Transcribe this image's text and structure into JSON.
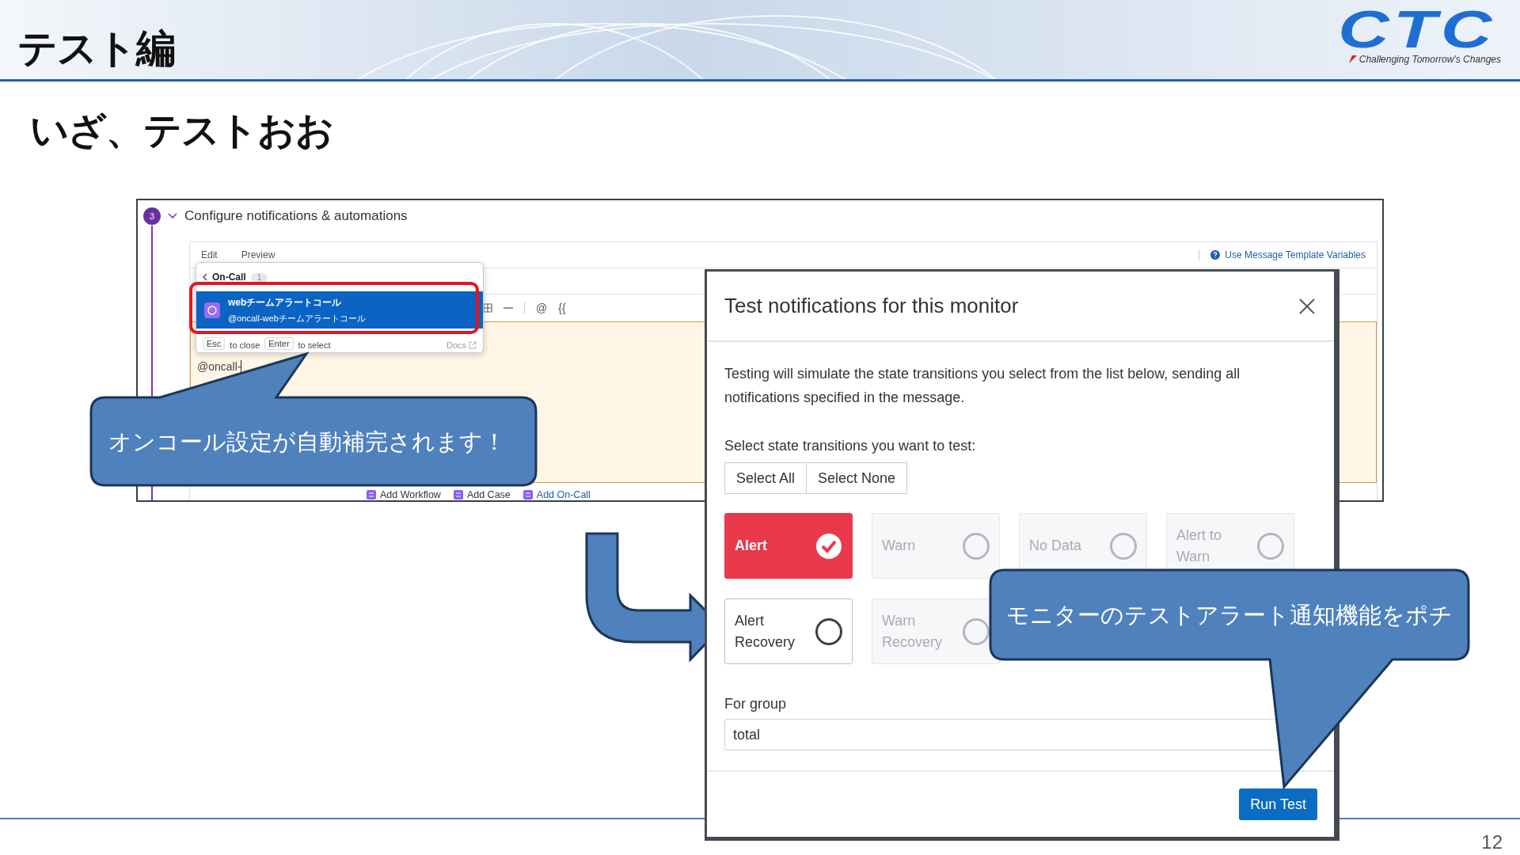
{
  "slide": {
    "title": "テスト編",
    "subtitle": "いざ、テストおお",
    "page_number": "12",
    "logo": {
      "text": "CTC",
      "tagline": "Challenging Tomorrow's Changes"
    }
  },
  "editor_screenshot": {
    "step_number": "3",
    "section_title": "Configure notifications & automations",
    "tabs": [
      "Edit",
      "Preview"
    ],
    "help_link": "Use Message Template Variables",
    "toolbar": [
      "@",
      "{{"
    ],
    "text_value": "@oncall-",
    "autocomplete": {
      "category": "On-Call",
      "count": "1",
      "items": [
        {
          "name": "webチームアラートコール",
          "handle": "@oncall-webチームアラートコール",
          "selected": true
        }
      ],
      "hints": [
        {
          "key": "Esc",
          "text": "to close"
        },
        {
          "key": "Enter",
          "text": "to select"
        }
      ],
      "docs_link": "Docs"
    },
    "footer_actions": [
      {
        "label": "Add Workflow",
        "kind": "action"
      },
      {
        "label": "Add Case",
        "kind": "action"
      },
      {
        "label": "Add On-Call",
        "kind": "link"
      }
    ]
  },
  "modal": {
    "title": "Test notifications for this monitor",
    "description": "Testing will simulate the state transitions you select from the list below, sending all notifications specified in the message.",
    "prompt": "Select state transitions you want to test:",
    "bulk_buttons": [
      "Select All",
      "Select None"
    ],
    "states": [
      {
        "label": "Alert",
        "selected": true,
        "disabled": false
      },
      {
        "label": "Warn",
        "selected": false,
        "disabled": true
      },
      {
        "label": "No Data",
        "selected": false,
        "disabled": true
      },
      {
        "label": "Alert to Warn",
        "selected": false,
        "disabled": true
      },
      {
        "label": "Alert Recovery",
        "selected": false,
        "disabled": false
      },
      {
        "label": "Warn Recovery",
        "selected": false,
        "disabled": true
      }
    ],
    "group_label": "For group",
    "group_value": "total",
    "run_button": "Run Test"
  },
  "callouts": [
    {
      "text": "オンコール設定が自動補完されます！"
    },
    {
      "text": "モニターのテストアラート通知機能をポチ"
    }
  ]
}
